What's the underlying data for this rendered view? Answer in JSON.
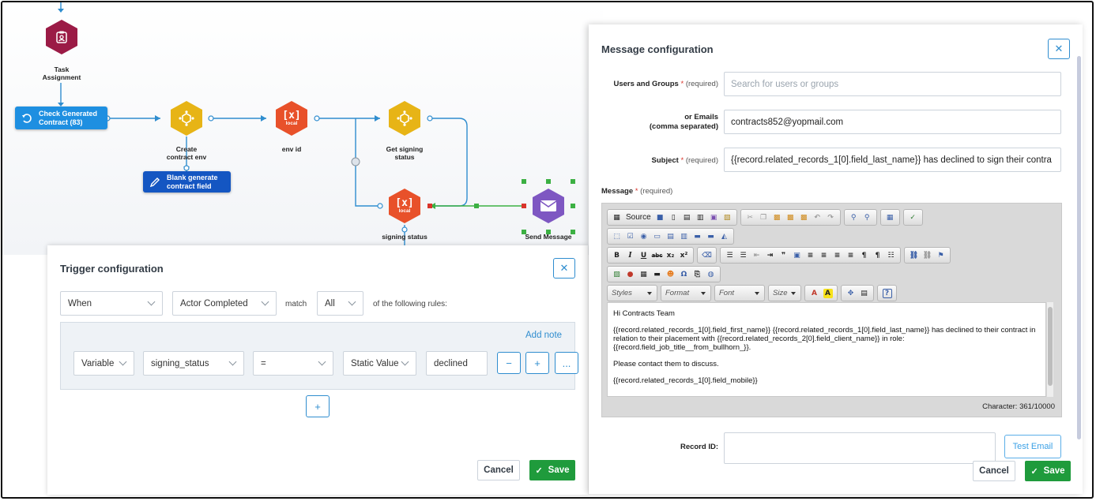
{
  "workflow": {
    "nodes": {
      "task_assignment": "Task\nAssignment",
      "check_generated": "Check Generated\nContract (83)",
      "create_env": "Create\ncontract env",
      "blank_generate": "Blank generate\ncontract field",
      "env_id": "env id",
      "get_signing": "Get signing\nstatus",
      "signing_status": "signing status",
      "send_message": "Send Message",
      "local_text": "local",
      "x_text": "[x]"
    },
    "colors": {
      "red": "#e8512a",
      "yellow": "#e7b416",
      "maroon": "#9b1b46",
      "purple": "#7e57c2",
      "pill_blue": "#1e8fe1",
      "pill_dark": "#1456c2",
      "connector": "#2f8dcf",
      "selection": "#3cb043"
    }
  },
  "trigger": {
    "title": "Trigger configuration",
    "close": "✕",
    "when": "When",
    "event": "Actor Completed",
    "match_label": "match",
    "match_value": "All",
    "rules_text": "of the following rules:",
    "add_note": "Add note",
    "rule": {
      "type": "Variable",
      "variable": "signing_status",
      "operator": "=",
      "value_type": "Static Value",
      "value": "declined"
    },
    "minus": "−",
    "plus": "+",
    "more": "...",
    "add_rule": "+",
    "cancel": "Cancel",
    "save": "Save"
  },
  "message": {
    "title": "Message configuration",
    "close": "✕",
    "users_label": "Users and Groups",
    "required_star": "*",
    "required_text": "(required)",
    "users_placeholder": "Search for users or groups",
    "emails_label_1": "or Emails",
    "emails_label_2": "(comma separated)",
    "emails_value": "contracts852@yopmail.com",
    "subject_label": "Subject",
    "subject_value": "{{record.related_records_1[0].field_last_name}} has declined to sign their contra",
    "message_label": "Message",
    "toolbar": {
      "source": "Source",
      "styles": "Styles",
      "format": "Format",
      "font": "Font",
      "size": "Size"
    },
    "body": [
      "Hi Contracts Team",
      "{{record.related_records_1[0].field_first_name}} {{record.related_records_1[0].field_last_name}} has declined to their contract in relation to their placement with {{record.related_records_2[0].field_client_name}} in role: {{record.field_job_title__from_bullhorn_}}.",
      "Please contact them to discuss.",
      "{{record.related_records_1[0].field_mobile}}"
    ],
    "char_count": "Character: 361/10000",
    "record_label": "Record ID:",
    "test_email": "Test Email",
    "cancel": "Cancel",
    "save": "Save"
  }
}
